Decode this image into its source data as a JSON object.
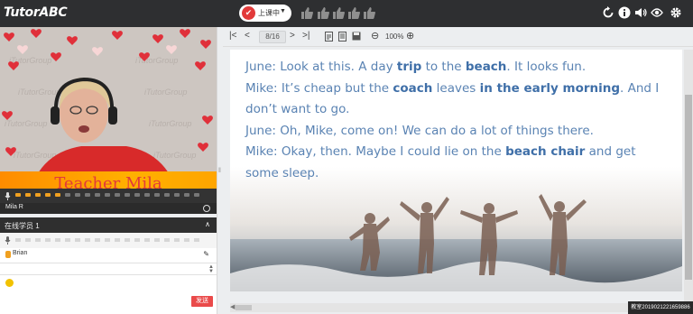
{
  "app": {
    "logo": "TutorABC"
  },
  "topbar": {
    "status_icon": "✔",
    "status_label": "上课中",
    "status_caret": "▼",
    "thumbs_count": 5,
    "icons": [
      "refresh-icon",
      "info-icon",
      "volume-icon",
      "eye-icon",
      "settings-icon"
    ]
  },
  "video": {
    "teacher_name": "Teacher Mila",
    "teacher_label": "Mila R",
    "watermark": "iTutorGroup"
  },
  "students": {
    "title": "在线学员 1",
    "caret": "∧",
    "list": [
      {
        "name": "Brian"
      }
    ],
    "send_label": "发送"
  },
  "slide_toolbar": {
    "first": "|<",
    "prev": "<",
    "page": "8/16",
    "next": ">",
    "last": ">|",
    "zoom_out": "⊖",
    "zoom": "100%",
    "zoom_in": "⊕"
  },
  "slide": {
    "lines": [
      [
        {
          "t": "June: Look at this. A day "
        },
        {
          "t": "trip",
          "b": true
        },
        {
          "t": " to the "
        },
        {
          "t": "beach",
          "b": true
        },
        {
          "t": ". It looks fun."
        }
      ],
      [
        {
          "t": "Mike: It’s cheap but the "
        },
        {
          "t": "coach",
          "b": true
        },
        {
          "t": " leaves "
        },
        {
          "t": "in the early morning",
          "b": true
        },
        {
          "t": ". And I"
        }
      ],
      [
        {
          "t": "don’t want to go."
        }
      ],
      [
        {
          "t": "June: Oh, Mike, come on! We can do a lot of things there."
        }
      ],
      [
        {
          "t": "Mike: Okay, then. Maybe I could lie on the "
        },
        {
          "t": "beach chair",
          "b": true
        },
        {
          "t": " and get"
        }
      ],
      [
        {
          "t": "some sleep."
        }
      ]
    ]
  },
  "session_id": "教室2019021221659886",
  "colors": {
    "accent_red": "#e23a3a",
    "slide_text": "#5a83b3",
    "topbar": "#2e2f31",
    "banner_orange": "#ff9a00"
  }
}
